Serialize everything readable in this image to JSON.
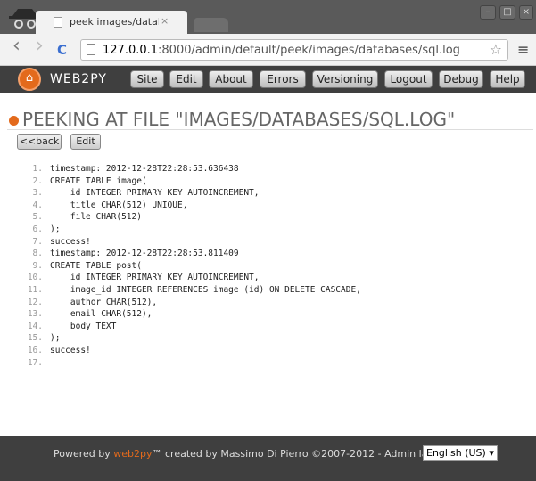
{
  "browser": {
    "tab_title": "peek images/databases/sq",
    "tab_close": "×",
    "url_host": "127.0.0.1",
    "url_rest": ":8000/admin/default/peek/images/databases/sql.log",
    "win_min": "–",
    "win_max": "□",
    "win_close": "×",
    "back_icon": "‹",
    "forward_icon": "›",
    "reload_icon": "C",
    "star_icon": "☆",
    "menu_icon": "≡"
  },
  "header": {
    "logo": "WEB2PY",
    "nav": [
      "Site",
      "Edit",
      "About",
      "Errors",
      "Versioning",
      "Logout",
      "Debug",
      "Help"
    ]
  },
  "main": {
    "title": "PEEKING AT FILE \"IMAGES/DATABASES/SQL.LOG\"",
    "back_label": "<<back",
    "edit_label": "Edit",
    "lines": [
      "timestamp: 2012-12-28T22:28:53.636438",
      "CREATE TABLE image(",
      "    id INTEGER PRIMARY KEY AUTOINCREMENT,",
      "    title CHAR(512) UNIQUE,",
      "    file CHAR(512)",
      ");",
      "success!",
      "timestamp: 2012-12-28T22:28:53.811409",
      "CREATE TABLE post(",
      "    id INTEGER PRIMARY KEY AUTOINCREMENT,",
      "    image_id INTEGER REFERENCES image (id) ON DELETE CASCADE,",
      "    author CHAR(512),",
      "    email CHAR(512),",
      "    body TEXT",
      ");",
      "success!",
      ""
    ]
  },
  "footer": {
    "powered_by": "Powered by ",
    "link": "web2py",
    "rest": "™ created by Massimo Di Pierro ©2007-2012 - Admin language",
    "language": "English (US)"
  },
  "colors": {
    "accent": "#e36a1c",
    "header_bg": "#3f3f3f"
  }
}
